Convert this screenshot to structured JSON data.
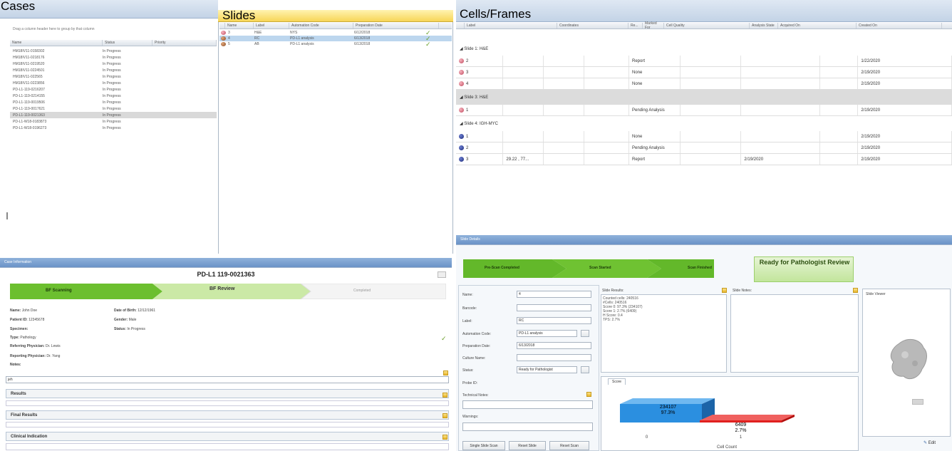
{
  "headings": {
    "cases": "Cases",
    "slides": "Slides",
    "cells": "Cells/Frames"
  },
  "cases": {
    "group_hint": "Drag a column header here to group by that column",
    "columns": [
      "Name",
      "Status",
      "Priority"
    ],
    "rows": [
      {
        "name": "HM18IV11-0158302",
        "status": "In Progress"
      },
      {
        "name": "HM18IV11-0218176",
        "status": "In Progress"
      },
      {
        "name": "HM18IV11-0219520",
        "status": "In Progress"
      },
      {
        "name": "HM18IV11-0224501",
        "status": "In Progress"
      },
      {
        "name": "HM18IV11-022565",
        "status": "In Progress"
      },
      {
        "name": "HM18IV11-0223856",
        "status": "In Progress"
      },
      {
        "name": "PD-L1-119-0216207",
        "status": "In Progress"
      },
      {
        "name": "PD-L1-119-0214155",
        "status": "In Progress"
      },
      {
        "name": "PD-L1-119-0019506",
        "status": "In Progress"
      },
      {
        "name": "PD-L1-119-0017621",
        "status": "In Progress"
      },
      {
        "name": "PD-L1-119-0021363",
        "status": "In Progress"
      },
      {
        "name": "PD-L1-W18-0183873",
        "status": "In Progress"
      },
      {
        "name": "PD-L1-W18-0196273",
        "status": "In Progress"
      }
    ]
  },
  "slides": {
    "columns": [
      "Name",
      "Label",
      "Automation Code",
      "Preparation Date"
    ],
    "rows": [
      {
        "name": "3",
        "label": "H&E",
        "code": "NYS",
        "date": "6/12/2018",
        "check": "✓"
      },
      {
        "name": "4",
        "label": "RC",
        "code": "PD-L1 analysis",
        "date": "6/13/2018",
        "check": "✓"
      },
      {
        "name": "5",
        "label": "AB",
        "code": "PD-L1 analysis",
        "date": "6/13/2018",
        "check": "✓"
      }
    ]
  },
  "cells": {
    "columns": [
      "Label",
      "Coordinates",
      "Re...",
      "Marked For",
      "Cell Quality",
      "Analysis State",
      "Acquired On",
      "Created On"
    ],
    "groups": [
      {
        "title": "◢ Slide 1: H&E",
        "rows": [
          {
            "label": "2",
            "coords": "",
            "marked": "Report",
            "analysis": "",
            "created": "1/22/2020"
          },
          {
            "label": "3",
            "coords": "",
            "marked": "None",
            "analysis": "",
            "created": "2/19/2020"
          },
          {
            "label": "4",
            "coords": "",
            "marked": "None",
            "analysis": "",
            "created": "2/19/2020"
          }
        ]
      },
      {
        "title": "◢ Slide 3: H&E",
        "rows": [
          {
            "label": "1",
            "coords": "",
            "marked": "Pending Analysis",
            "analysis": "",
            "created": "2/19/2020"
          }
        ]
      },
      {
        "title": "◢ Slide 4: IGH-MYC",
        "rows": [
          {
            "label": "1",
            "coords": "",
            "marked": "None",
            "analysis": "",
            "created": "2/19/2020"
          },
          {
            "label": "2",
            "coords": "",
            "marked": "Pending Analysis",
            "analysis": "",
            "created": "2/19/2020"
          },
          {
            "label": "3",
            "coords": "29.22 , 77...",
            "marked": "Report",
            "analysis": "2/19/2020",
            "created": "2/19/2020"
          }
        ]
      }
    ]
  },
  "case_info": {
    "panel_title": "Case Information",
    "case_id": "PD-L1 119-0021363",
    "steps": [
      "BF Scanning",
      "BF Review",
      "Completed"
    ],
    "name_label": "Name:",
    "name": "John Doe",
    "dob_label": "Date of Birth:",
    "dob": "12/12/1961",
    "patient_label": "Patient ID:",
    "patient": "12345678",
    "gender_label": "Gender:",
    "gender": "Male",
    "specimen_label": "Specimen:",
    "status_label": "Status:",
    "status": "In Progress",
    "type_label": "Type:",
    "type": "Pathology",
    "referring_label": "Referring Physician:",
    "referring": "Dr. Lewis",
    "reporting_label": "Reporting Physician:",
    "reporting": "Dr. Yang",
    "notes_label": "Notes:",
    "notes_value": "jeh",
    "sections": [
      "Results",
      "Final Results",
      "Clinical Indication"
    ]
  },
  "slide_details": {
    "panel_title": "Slide Details",
    "steps": [
      "Pre-Scan Completed",
      "Scan Started",
      "Scan Finished",
      "Ready for Pathologist Review"
    ],
    "name_label": "Name:",
    "name": "4",
    "barcode_label": "Barcode:",
    "barcode": "",
    "label_label": "Label:",
    "label": "RC",
    "automation_label": "Automation Code:",
    "automation": "PD-L1 analysis",
    "prep_label": "Preparation Date:",
    "prep": "6/13/2018",
    "culture_label": "Culture Name:",
    "culture": "",
    "status_label": "Status:",
    "status": "Ready for Pathologist",
    "probe_label": "Probe ID:",
    "technical_label": "Technical Notes:",
    "warnings_label": "Warnings:",
    "results_label": "Slide Results:",
    "results_lines": [
      "Counted cells: 240516",
      "#Cells: 240516",
      "Score 0: 97.3% (234107)",
      "Score 1: 2.7% (6409)",
      "H Score: 0.4",
      "TPS: 2.7%"
    ],
    "notes_label": "Slide Notes:",
    "viewer_label": "Slide Viewer",
    "score_tab": "Score",
    "buttons": [
      "Single Slide Scan",
      "Reset Slide",
      "Reset Scan"
    ],
    "edit_label": "Edit"
  },
  "chart_data": {
    "type": "bar",
    "categories": [
      "0",
      "1"
    ],
    "values": [
      234107,
      6409
    ],
    "data_labels": [
      "234107\n97.3%",
      "6409\n2.7%"
    ],
    "xlabel": "Cell Count",
    "colors": [
      "#2b8fe0",
      "#e0211f"
    ]
  }
}
